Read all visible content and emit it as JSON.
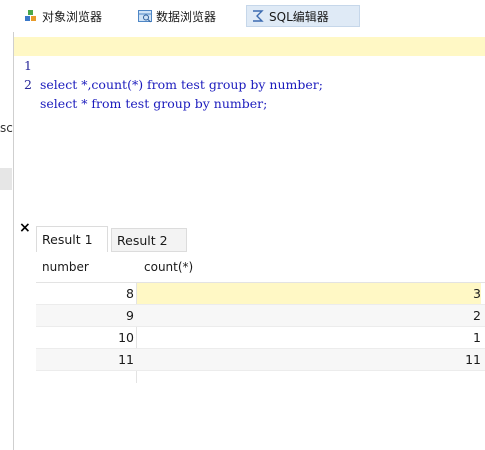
{
  "tabs": [
    {
      "label": "对象浏览器",
      "icon": "object-browser-icon"
    },
    {
      "label": "数据浏览器",
      "icon": "data-browser-icon"
    },
    {
      "label": "SQL编辑器",
      "icon": "sql-editor-icon"
    }
  ],
  "left_fragment": {
    "text": "sc"
  },
  "editor": {
    "lines": [
      {
        "number": "1",
        "code": "select *,count(*) from test group by number;"
      },
      {
        "number": "2",
        "code": "select * from test group by number;"
      }
    ]
  },
  "results": {
    "close_symbol": "×",
    "tabs": [
      {
        "label": "Result 1"
      },
      {
        "label": "Result 2"
      }
    ],
    "columns": [
      "number",
      "count(*)"
    ],
    "rows": [
      {
        "number": "8",
        "count": "3"
      },
      {
        "number": "9",
        "count": "2"
      },
      {
        "number": "10",
        "count": "1"
      },
      {
        "number": "11",
        "count": "11"
      }
    ]
  },
  "colors": {
    "active_tab": "#dfeaf6",
    "current_line": "#fff8c5",
    "keyword": "#1b1bbd"
  }
}
